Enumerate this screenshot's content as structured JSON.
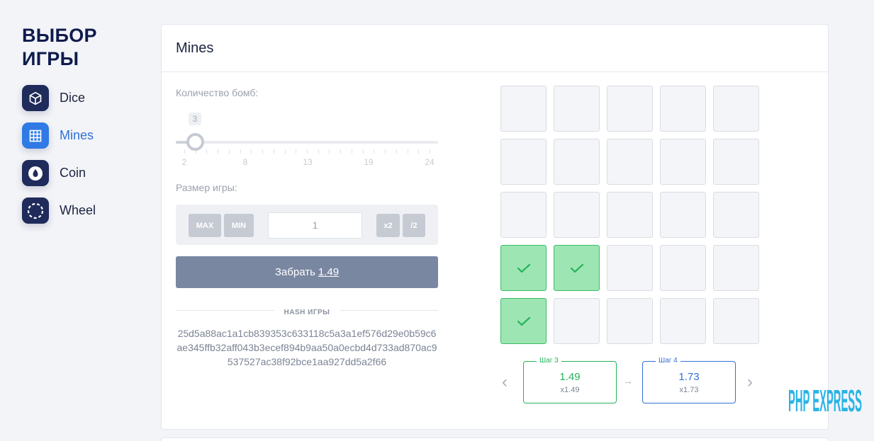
{
  "sidebar": {
    "title_line1": "ВЫБОР",
    "title_line2": "ИГРЫ",
    "games": [
      {
        "label": "Dice",
        "icon": "cube-icon"
      },
      {
        "label": "Mines",
        "icon": "grid-icon",
        "active": true
      },
      {
        "label": "Coin",
        "icon": "coin-icon"
      },
      {
        "label": "Wheel",
        "icon": "wheel-icon"
      }
    ]
  },
  "card": {
    "title": "Mines"
  },
  "controls": {
    "bombs_label": "Количество бомб:",
    "bombs_value": "3",
    "bombs_min": 2,
    "bombs_max": 24,
    "slider_ticks": [
      "2",
      "8",
      "13",
      "19",
      "24"
    ],
    "size_label": "Размер игры:",
    "max_label": "MAX",
    "min_label": "MIN",
    "bet_value": "1",
    "x2_label": "x2",
    "half_label": "/2",
    "cashout_label": "Забрать",
    "cashout_amount": "1.49",
    "hash_title": "HASH ИГРЫ",
    "hash_value": "25d5a88ac1a1cb839353c633118c5a3a1ef576d29e0b59c6ae345ffb32aff043b3ecef894b9aa50a0ecbd4d733ad870ac9537527ac38f92bce1aa927dd5a2f66"
  },
  "grid": {
    "opened_cells": [
      15,
      16,
      20
    ]
  },
  "steps": {
    "current": {
      "tag": "Шаг 3",
      "value": "1.49",
      "mult": "x1.49"
    },
    "next": {
      "tag": "Шаг 4",
      "value": "1.73",
      "mult": "x1.73"
    }
  },
  "watermark": "PHP EXPRESS",
  "colors": {
    "accent_blue": "#2f72d8",
    "success_green": "#27b35a",
    "opened_cell": "#9de6b4",
    "cashout_button": "#7987a1",
    "icon_navy": "#1f2b5a"
  }
}
